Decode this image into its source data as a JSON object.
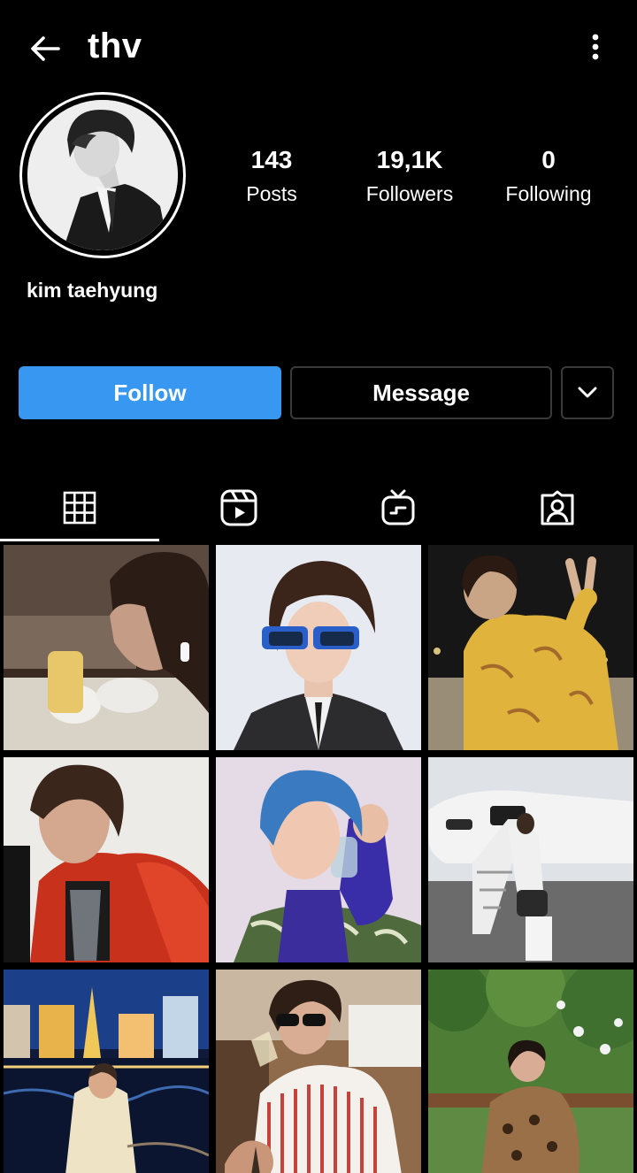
{
  "header": {
    "username": "thv",
    "back_icon": "arrow-left-icon",
    "more_icon": "more-vertical-icon"
  },
  "profile": {
    "display_name": "kim taehyung",
    "stats": {
      "posts": {
        "value": "143",
        "label": "Posts"
      },
      "followers": {
        "value": "19,1K",
        "label": "Followers"
      },
      "following": {
        "value": "0",
        "label": "Following"
      }
    }
  },
  "actions": {
    "follow_label": "Follow",
    "message_label": "Message",
    "suggestions_icon": "chevron-down-icon"
  },
  "tabs": [
    {
      "name": "posts",
      "icon": "grid-icon",
      "active": true
    },
    {
      "name": "reels",
      "icon": "reels-icon",
      "active": false
    },
    {
      "name": "igtv",
      "icon": "igtv-icon",
      "active": false
    },
    {
      "name": "tagged",
      "icon": "tagged-person-icon",
      "active": false
    }
  ],
  "colors": {
    "background": "#000000",
    "follow_button": "#3897f0",
    "border": "#3a3a3a",
    "text": "#ffffff"
  },
  "posts": [
    {
      "description": "photo"
    },
    {
      "description": "photo"
    },
    {
      "description": "photo"
    },
    {
      "description": "photo"
    },
    {
      "description": "photo"
    },
    {
      "description": "photo"
    },
    {
      "description": "photo"
    },
    {
      "description": "photo"
    },
    {
      "description": "photo"
    }
  ]
}
